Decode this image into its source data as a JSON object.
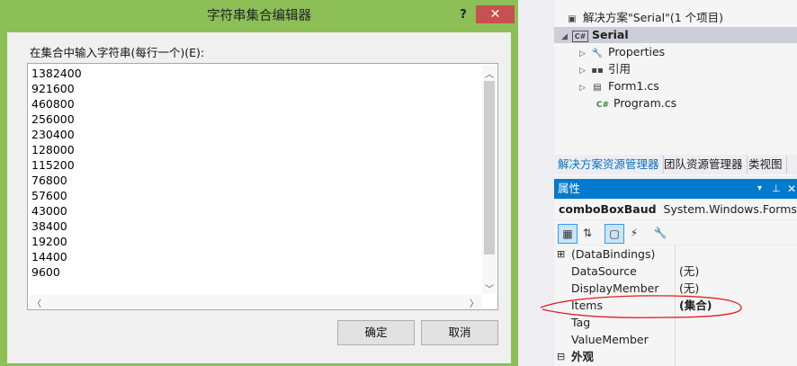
{
  "solution_explorer": {
    "solution_label": "解决方案\"Serial\"(1 个项目)",
    "project_label": "Serial",
    "items": [
      {
        "label": "Properties",
        "icon": "wrench-icon"
      },
      {
        "label": "引用",
        "icon": "references-icon"
      },
      {
        "label": "Form1.cs",
        "icon": "form-icon"
      },
      {
        "label": "Program.cs",
        "icon": "csharp-icon"
      }
    ]
  },
  "tabs": [
    "解决方案资源管理器",
    "团队资源管理器",
    "类视图"
  ],
  "properties": {
    "header": "属性",
    "object_name": "comboBoxBaud",
    "object_type": "System.Windows.Forms.Co",
    "rows": [
      {
        "name": "(DataBindings)",
        "value": ""
      },
      {
        "name": "DataSource",
        "value": "(无)"
      },
      {
        "name": "DisplayMember",
        "value": "(无)"
      },
      {
        "name": "Items",
        "value": "(集合)"
      },
      {
        "name": "Tag",
        "value": ""
      },
      {
        "name": "ValueMember",
        "value": ""
      }
    ],
    "category": "外观"
  },
  "dialog": {
    "title": "字符串集合编辑器",
    "help": "?",
    "close": "✕",
    "prompt": "在集合中输入字符串(每行一个)(E):",
    "items": [
      "1382400",
      "921600",
      "460800",
      "256000",
      "230400",
      "128000",
      "115200",
      "76800",
      "57600",
      "43000",
      "38400",
      "19200",
      "14400",
      "9600"
    ],
    "ok_label": "确定",
    "cancel_label": "取消"
  },
  "colors": {
    "dialog_border": "#8cbf56",
    "accent": "#007acc",
    "close": "#c75050",
    "annotation": "#e02020"
  }
}
